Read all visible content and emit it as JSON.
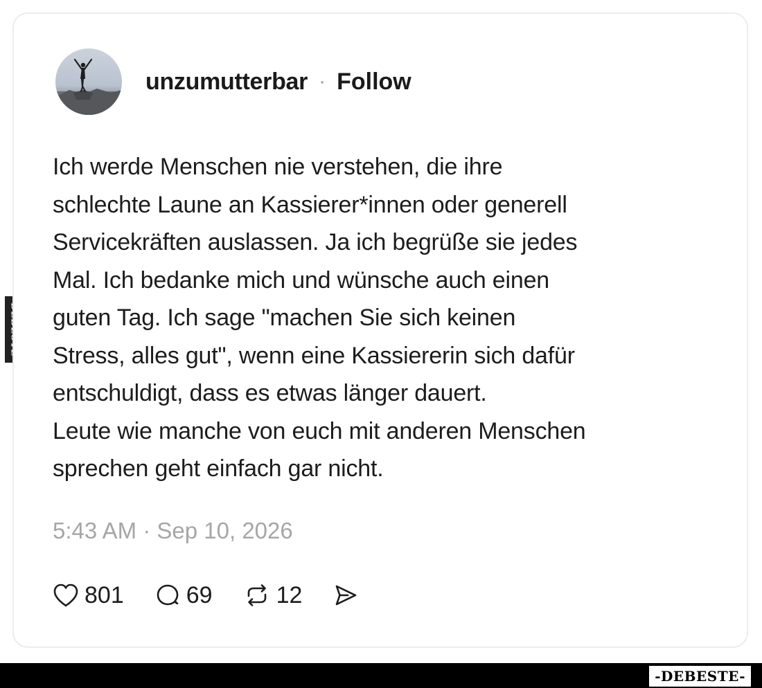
{
  "post": {
    "username": "unzumutterbar",
    "separator": "·",
    "follow_label": "Follow",
    "text": "Ich werde Menschen nie verstehen, die ihre\nschlechte Laune an Kassierer*innen oder generell\nServicekräften auslassen. Ja ich begrüße sie jedes\nMal. Ich bedanke mich und wünsche auch einen\nguten Tag. Ich sage \"machen Sie sich keinen\nStress, alles gut\", wenn eine Kassiererin sich dafür\nentschuldigt, dass es etwas länger dauert.\nLeute wie manche von euch mit anderen Menschen\nsprechen geht einfach gar nicht.",
    "timestamp": "5:43 AM · Sep 10, 2026",
    "stats": {
      "likes": "801",
      "replies": "69",
      "reposts": "12"
    },
    "icons": {
      "like": "heart-icon",
      "reply": "comment-bubble-icon",
      "repost": "repost-icon",
      "share": "share-send-icon"
    }
  },
  "watermark": {
    "side": "DEBESTE",
    "footer": "-DEBESTE-"
  },
  "colors": {
    "text": "#1c1c1c",
    "muted": "#a6a6a6",
    "card_border": "#ececec",
    "footer_bar": "#000000"
  }
}
